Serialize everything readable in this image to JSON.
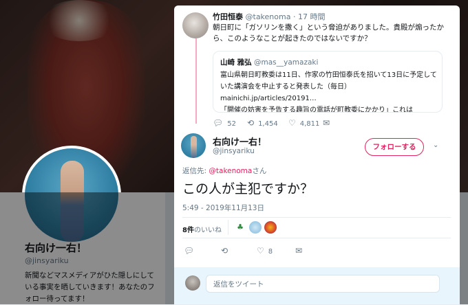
{
  "profile": {
    "name": "右向け一右！",
    "handle": "@jinsyariku",
    "bio": "新聞などマスメディアがひた隠しにしている事実を晒していきます！あなたのフォロー待ってます！"
  },
  "thread": {
    "parent": {
      "name": "竹田恒泰",
      "handle": "@takenoma",
      "time": "· 17 時間",
      "text": "朝日町に「ガソリンを撒く」という脅迫がありました。貴殿が煽ったから、このようなことが起きたのではないですか？",
      "quote": {
        "name": "山崎 雅弘",
        "handle": "@mas__yamazaki",
        "text_line1": "富山県朝日町教委は11日、作家の竹田恒泰氏を招いて13日に予定していた講演会を中止すると発表した（毎日）mainichi.jp/articles/20191…",
        "text_line2": "「開催の妨害を予告する趣旨の電話が町教委にかかり」これは"
      },
      "actions": {
        "replies": "52",
        "retweets": "1,454",
        "likes": "4,811"
      }
    },
    "focus": {
      "name": "右向け一右！",
      "handle": "@jinsyariku",
      "follow_label": "フォローする",
      "reply_to_prefix": "返信先: ",
      "reply_to_handle": "@takenoma",
      "reply_to_suffix": "さん",
      "text": "この人が主犯ですか？",
      "timestamp": "5:49 - 2019年11月13日",
      "likes_count": "8件",
      "likes_label": "のいいね",
      "actions": {
        "likes": "8"
      }
    }
  },
  "reply_box": {
    "placeholder": "返信をツイート"
  },
  "icons": {
    "reply": "reply-icon",
    "retweet": "retweet-icon",
    "like": "heart-icon",
    "message": "envelope-icon",
    "more": "chevron-down-icon"
  },
  "colors": {
    "accent": "#e0245e",
    "thread_line": "#f7a8c2",
    "reply_bar": "#e8f5fd"
  }
}
